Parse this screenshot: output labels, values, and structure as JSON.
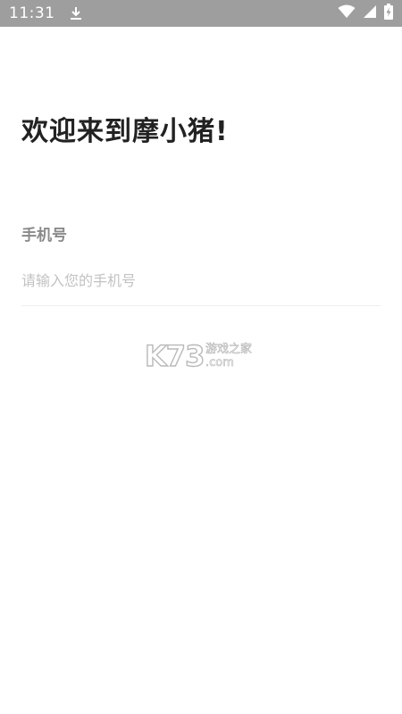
{
  "status_bar": {
    "time": "11:31",
    "bg_color": "#9e9e9e",
    "icons": [
      "download-icon",
      "wifi-icon",
      "cellular-signal-icon",
      "battery-icon"
    ]
  },
  "login": {
    "title": "欢迎来到摩小猪!",
    "phone_label": "手机号",
    "phone_placeholder": "请输入您的手机号",
    "phone_value": ""
  },
  "watermark": {
    "brand": "K73",
    "tagline": "游戏之家",
    "domain": ".com"
  }
}
